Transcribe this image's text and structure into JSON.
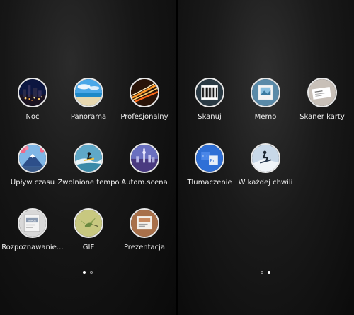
{
  "left_page": {
    "modes": [
      {
        "label": "Noc",
        "icon": "night-city-icon"
      },
      {
        "label": "Panorama",
        "icon": "panorama-beach-icon"
      },
      {
        "label": "Profesjonalny",
        "icon": "light-trails-icon"
      },
      {
        "label": "Upływ czasu",
        "icon": "mount-fuji-icon"
      },
      {
        "label": "Zwolnione tempo",
        "icon": "surfer-icon"
      },
      {
        "label": "Autom.scena",
        "icon": "city-skyline-icon"
      },
      {
        "label": "Rozpoznawanie…",
        "icon": "image-recognition-icon"
      },
      {
        "label": "GIF",
        "icon": "hummingbird-icon"
      },
      {
        "label": "Prezentacja",
        "icon": "presentation-icon"
      }
    ],
    "page_index": 1
  },
  "right_page": {
    "modes": [
      {
        "label": "Skanuj",
        "icon": "barcode-icon"
      },
      {
        "label": "Memo",
        "icon": "memo-photo-icon"
      },
      {
        "label": "Skaner karty",
        "icon": "business-card-icon"
      },
      {
        "label": "Tłumaczenie",
        "icon": "translate-icon"
      },
      {
        "label": "W każdej chwili",
        "icon": "any-time-snowboard-icon"
      }
    ],
    "page_index": 2
  },
  "colors": {
    "icon_border": "#e8e8e8",
    "label_text": "#f0f0f0",
    "translate_blue": "#2f6fd6"
  }
}
